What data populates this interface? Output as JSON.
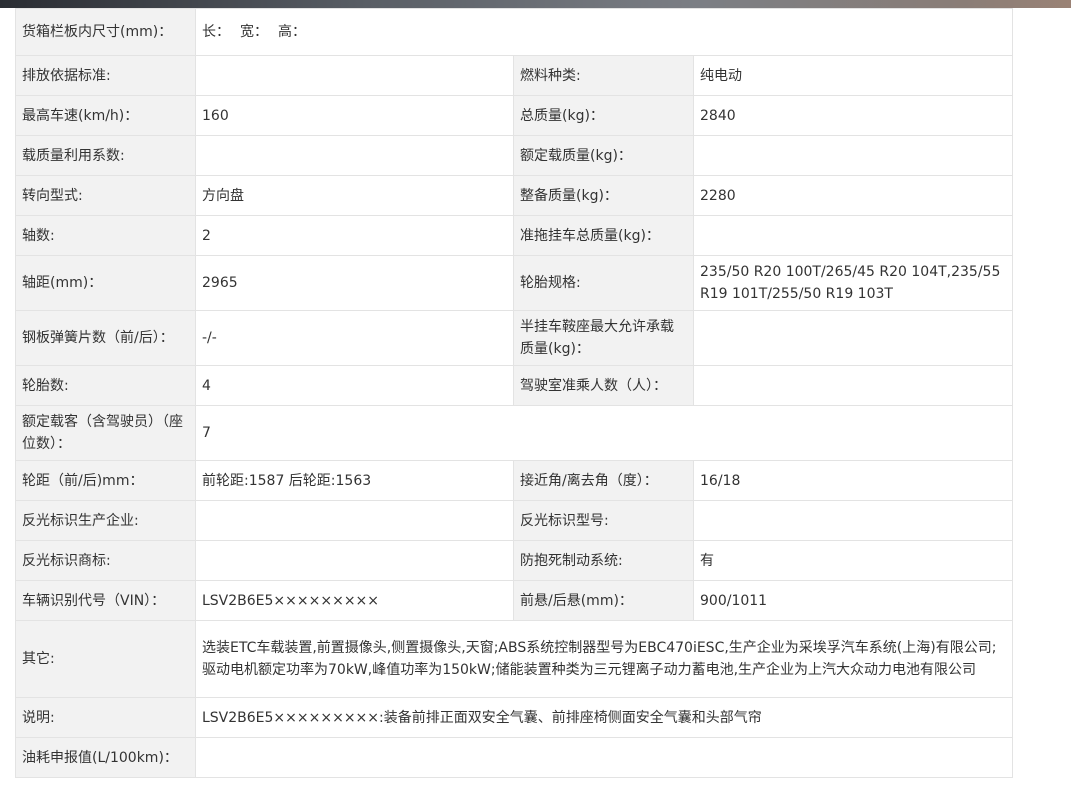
{
  "rows": {
    "cargo_box": {
      "label": "货箱栏板内尺寸(mm)：",
      "length": "长：",
      "width": "宽：",
      "height": "高："
    },
    "r1": {
      "l1": "排放依据标准:",
      "v1": "",
      "l2": "燃料种类:",
      "v2": "纯电动"
    },
    "r2": {
      "l1": "最高车速(km/h)：",
      "v1": "160",
      "l2": "总质量(kg)：",
      "v2": "2840"
    },
    "r3": {
      "l1": "载质量利用系数:",
      "v1": "",
      "l2": "额定载质量(kg)：",
      "v2": ""
    },
    "r4": {
      "l1": "转向型式:",
      "v1": "方向盘",
      "l2": "整备质量(kg)：",
      "v2": "2280"
    },
    "r5": {
      "l1": "轴数:",
      "v1": "2",
      "l2": "准拖挂车总质量(kg)：",
      "v2": ""
    },
    "r6": {
      "l1": "轴距(mm)：",
      "v1": "2965",
      "l2": "轮胎规格:",
      "v2": "235/50 R20 100T/265/45 R20 104T,235/55 R19 101T/255/50 R19 103T"
    },
    "r7": {
      "l1": "钢板弹簧片数（前/后）：",
      "v1": "-/-",
      "l2": "半挂车鞍座最大允许承载质量(kg)：",
      "v2": ""
    },
    "r8": {
      "l1": "轮胎数:",
      "v1": "4",
      "l2": "驾驶室准乘人数（人）：",
      "v2": ""
    },
    "r9": {
      "l1": "额定载客（含驾驶员）（座位数）：",
      "v1": "7"
    },
    "r10": {
      "l1": "轮距（前/后)mm：",
      "v1": "前轮距:1587 后轮距:1563",
      "l2": "接近角/离去角（度）：",
      "v2": "16/18"
    },
    "r11": {
      "l1": "反光标识生产企业:",
      "v1": "",
      "l2": "反光标识型号:",
      "v2": ""
    },
    "r12": {
      "l1": "反光标识商标:",
      "v1": "",
      "l2": "防抱死制动系统:",
      "v2": "有"
    },
    "r13": {
      "l1": "车辆识别代号（VIN）：",
      "v1": "LSV2B6E5×××××××××",
      "l2": "前悬/后悬(mm)：",
      "v2": "900/1011"
    },
    "r14": {
      "l1": "其它:",
      "v1": "选装ETC车载装置,前置摄像头,侧置摄像头,天窗;ABS系统控制器型号为EBC470iESC,生产企业为采埃孚汽车系统(上海)有限公司;驱动电机额定功率为70kW,峰值功率为150kW;储能装置种类为三元锂离子动力蓄电池,生产企业为上汽大众动力电池有限公司"
    },
    "r15": {
      "l1": "说明:",
      "v1": "LSV2B6E5×××××××××:装备前排正面双安全气囊、前排座椅侧面安全气囊和头部气帘"
    },
    "r16": {
      "l1": "油耗申报值(L/100km)：",
      "v1": ""
    }
  }
}
